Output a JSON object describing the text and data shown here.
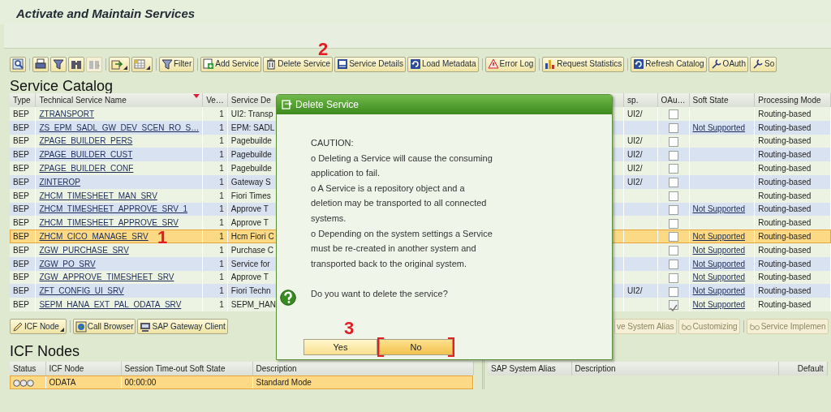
{
  "window": {
    "title": "Activate and Maintain Services"
  },
  "toolbar": [
    {
      "dropdown": false,
      "disabled": false
    },
    {
      "dropdown": false,
      "disabled": false
    },
    {
      "dropdown": false,
      "disabled": false
    },
    {
      "dropdown": false,
      "disabled": false
    },
    {
      "dropdown": false,
      "disabled": true
    },
    {
      "dropdown": true,
      "disabled": false
    },
    {
      "dropdown": true,
      "disabled": false
    },
    {
      "label": "Filter",
      "dropdown": false,
      "disabled": false
    },
    {
      "label": "Add Service",
      "dropdown": false,
      "disabled": false
    },
    {
      "label": "Delete Service",
      "dropdown": false,
      "disabled": false
    },
    {
      "label": "Service Details",
      "dropdown": false,
      "disabled": false
    },
    {
      "label": "Load Metadata",
      "dropdown": false,
      "disabled": false
    },
    {
      "label": "Error Log",
      "dropdown": false,
      "disabled": false
    },
    {
      "label": "Request Statistics",
      "dropdown": false,
      "disabled": false
    },
    {
      "label": "Refresh Catalog",
      "dropdown": false,
      "disabled": false
    },
    {
      "label": "OAuth",
      "dropdown": false,
      "disabled": false
    },
    {
      "label": "So",
      "dropdown": false,
      "disabled": false
    }
  ],
  "catalog": {
    "heading": "Service Catalog",
    "columns": [
      {
        "label": "Type"
      },
      {
        "label": "Technical Service Name",
        "sorted": true
      },
      {
        "label": "Ve…"
      },
      {
        "label": "Service De"
      },
      {
        "label": "sp."
      },
      {
        "label": "OAu…"
      },
      {
        "label": "Soft State"
      },
      {
        "label": "Processing Mode"
      }
    ],
    "rows": [
      {
        "type": "BEP",
        "name": "ZTRANSPORT",
        "version": "1",
        "description": "UI2: Transp",
        "namespace": "UI2/",
        "oauth": false,
        "soft_state": "",
        "mode": "Routing-based",
        "selected": false
      },
      {
        "type": "BEP",
        "name": "ZS_EPM_SADL_GW_DEV_SCEN_RO_S…",
        "version": "1",
        "description": "EPM: SADL",
        "namespace": "",
        "oauth": false,
        "soft_state": "Not Supported",
        "mode": "Routing-based",
        "selected": false
      },
      {
        "type": "BEP",
        "name": "ZPAGE_BUILDER_PERS",
        "version": "1",
        "description": "Pagebuilde",
        "namespace": "UI2/",
        "oauth": false,
        "soft_state": "",
        "mode": "Routing-based",
        "selected": false
      },
      {
        "type": "BEP",
        "name": "ZPAGE_BUILDER_CUST",
        "version": "1",
        "description": "Pagebuilde",
        "namespace": "UI2/",
        "oauth": false,
        "soft_state": "",
        "mode": "Routing-based",
        "selected": false
      },
      {
        "type": "BEP",
        "name": "ZPAGE_BUILDER_CONF",
        "version": "1",
        "description": "Pagebuilde",
        "namespace": "UI2/",
        "oauth": false,
        "soft_state": "",
        "mode": "Routing-based",
        "selected": false
      },
      {
        "type": "BEP",
        "name": "ZINTEROP",
        "version": "1",
        "description": "Gateway S",
        "namespace": "UI2/",
        "oauth": false,
        "soft_state": "",
        "mode": "Routing-based",
        "selected": false
      },
      {
        "type": "BEP",
        "name": "ZHCM_TIMESHEET_MAN_SRV",
        "version": "1",
        "description": "Fiori Times",
        "namespace": "",
        "oauth": false,
        "soft_state": "",
        "mode": "Routing-based",
        "selected": false
      },
      {
        "type": "BEP",
        "name": "ZHCM_TIMESHEET_APPROVE_SRV_1",
        "version": "1",
        "description": "Approve T",
        "namespace": "",
        "oauth": false,
        "soft_state": "Not Supported",
        "mode": "Routing-based",
        "selected": false
      },
      {
        "type": "BEP",
        "name": "ZHCM_TIMESHEET_APPROVE_SRV",
        "version": "1",
        "description": "Approve T",
        "namespace": "",
        "oauth": false,
        "soft_state": "",
        "mode": "Routing-based",
        "selected": false
      },
      {
        "type": "BEP",
        "name": "ZHCM_CICO_MANAGE_SRV",
        "version": "1",
        "description": "Hcm Fiori C",
        "namespace": "",
        "oauth": false,
        "soft_state": "Not Supported",
        "mode": "Routing-based",
        "selected": true
      },
      {
        "type": "BEP",
        "name": "ZGW_PURCHASE_SRV",
        "version": "1",
        "description": "Purchase C",
        "namespace": "",
        "oauth": false,
        "soft_state": "Not Supported",
        "mode": "Routing-based",
        "selected": false
      },
      {
        "type": "BEP",
        "name": "ZGW_PO_SRV",
        "version": "1",
        "description": "Service for",
        "namespace": "",
        "oauth": false,
        "soft_state": "Not Supported",
        "mode": "Routing-based",
        "selected": false
      },
      {
        "type": "BEP",
        "name": "ZGW_APPROVE_TIMESHEET_SRV",
        "version": "1",
        "description": "Approve T",
        "namespace": "",
        "oauth": false,
        "soft_state": "Not Supported",
        "mode": "Routing-based",
        "selected": false
      },
      {
        "type": "BEP",
        "name": "ZFT_CONFIG_UI_SRV",
        "version": "1",
        "description": "Fiori Techn",
        "namespace": "UI2/",
        "oauth": false,
        "soft_state": "Not Supported",
        "mode": "Routing-based",
        "selected": false
      },
      {
        "type": "BEP",
        "name": "SEPM_HANA_EXT_PAL_ODATA_SRV",
        "version": "1",
        "description": "SEPM_HAN",
        "namespace": "",
        "oauth": true,
        "soft_state": "Not Supported",
        "mode": "Routing-based",
        "selected": false
      }
    ]
  },
  "icf": {
    "toolbar": [
      {
        "label": "ICF Node",
        "dropdown": true
      },
      {
        "label": "Call Browser",
        "dropdown": false
      },
      {
        "label": "SAP Gateway Client",
        "dropdown": false
      }
    ],
    "heading": "ICF Nodes",
    "columns": [
      "Status",
      "ICF Node",
      "Session Time-out Soft State",
      "Description"
    ],
    "rows": [
      {
        "node": "ODATA",
        "timeout": "00:00:00",
        "description": "Standard Mode",
        "selected": true
      }
    ]
  },
  "alias": {
    "toolbar": [
      {
        "label": "ve System Alias",
        "disabled": true
      },
      {
        "label": "Customizing",
        "disabled": true
      },
      {
        "label": "Service Implemen",
        "disabled": true
      }
    ],
    "columns": [
      "SAP System Alias",
      "Description",
      "Default"
    ]
  },
  "dialog": {
    "title": "Delete Service",
    "lines": [
      "CAUTION:",
      "o Deleting a Service will cause the consuming",
      "application to fail.",
      "o A Service is a repository object and a",
      "deletion may be transported to all connected",
      "systems.",
      "o Depending on the system settings a Service",
      "must be re-created in another system and",
      "transported back to the original system."
    ],
    "question": "Do you want to delete the service?",
    "buttons": [
      {
        "label": "Yes",
        "focused": false
      },
      {
        "label": "No",
        "focused": true
      }
    ]
  },
  "annotations": [
    {
      "label": "2"
    },
    {
      "label": "1"
    },
    {
      "label": "3"
    }
  ]
}
